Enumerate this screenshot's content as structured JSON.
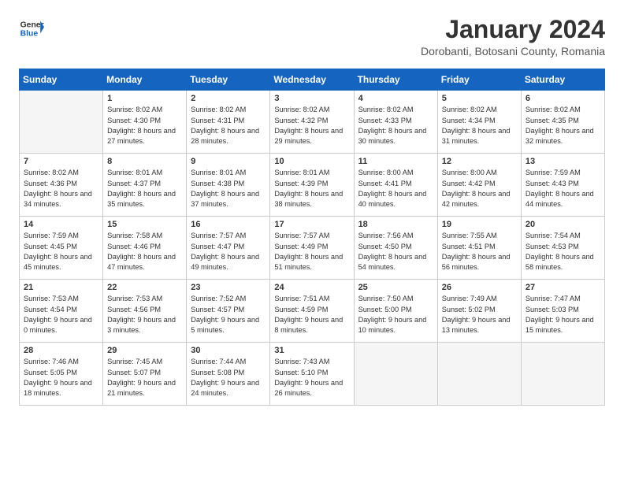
{
  "logo": {
    "line1": "General",
    "line2": "Blue"
  },
  "title": "January 2024",
  "subtitle": "Dorobanti, Botosani County, Romania",
  "days_of_week": [
    "Sunday",
    "Monday",
    "Tuesday",
    "Wednesday",
    "Thursday",
    "Friday",
    "Saturday"
  ],
  "weeks": [
    [
      {
        "day": "",
        "empty": true
      },
      {
        "day": "1",
        "sunrise": "8:02 AM",
        "sunset": "4:30 PM",
        "daylight": "8 hours and 27 minutes."
      },
      {
        "day": "2",
        "sunrise": "8:02 AM",
        "sunset": "4:31 PM",
        "daylight": "8 hours and 28 minutes."
      },
      {
        "day": "3",
        "sunrise": "8:02 AM",
        "sunset": "4:32 PM",
        "daylight": "8 hours and 29 minutes."
      },
      {
        "day": "4",
        "sunrise": "8:02 AM",
        "sunset": "4:33 PM",
        "daylight": "8 hours and 30 minutes."
      },
      {
        "day": "5",
        "sunrise": "8:02 AM",
        "sunset": "4:34 PM",
        "daylight": "8 hours and 31 minutes."
      },
      {
        "day": "6",
        "sunrise": "8:02 AM",
        "sunset": "4:35 PM",
        "daylight": "8 hours and 32 minutes."
      }
    ],
    [
      {
        "day": "7",
        "sunrise": "8:02 AM",
        "sunset": "4:36 PM",
        "daylight": "8 hours and 34 minutes."
      },
      {
        "day": "8",
        "sunrise": "8:01 AM",
        "sunset": "4:37 PM",
        "daylight": "8 hours and 35 minutes."
      },
      {
        "day": "9",
        "sunrise": "8:01 AM",
        "sunset": "4:38 PM",
        "daylight": "8 hours and 37 minutes."
      },
      {
        "day": "10",
        "sunrise": "8:01 AM",
        "sunset": "4:39 PM",
        "daylight": "8 hours and 38 minutes."
      },
      {
        "day": "11",
        "sunrise": "8:00 AM",
        "sunset": "4:41 PM",
        "daylight": "8 hours and 40 minutes."
      },
      {
        "day": "12",
        "sunrise": "8:00 AM",
        "sunset": "4:42 PM",
        "daylight": "8 hours and 42 minutes."
      },
      {
        "day": "13",
        "sunrise": "7:59 AM",
        "sunset": "4:43 PM",
        "daylight": "8 hours and 44 minutes."
      }
    ],
    [
      {
        "day": "14",
        "sunrise": "7:59 AM",
        "sunset": "4:45 PM",
        "daylight": "8 hours and 45 minutes."
      },
      {
        "day": "15",
        "sunrise": "7:58 AM",
        "sunset": "4:46 PM",
        "daylight": "8 hours and 47 minutes."
      },
      {
        "day": "16",
        "sunrise": "7:57 AM",
        "sunset": "4:47 PM",
        "daylight": "8 hours and 49 minutes."
      },
      {
        "day": "17",
        "sunrise": "7:57 AM",
        "sunset": "4:49 PM",
        "daylight": "8 hours and 51 minutes."
      },
      {
        "day": "18",
        "sunrise": "7:56 AM",
        "sunset": "4:50 PM",
        "daylight": "8 hours and 54 minutes."
      },
      {
        "day": "19",
        "sunrise": "7:55 AM",
        "sunset": "4:51 PM",
        "daylight": "8 hours and 56 minutes."
      },
      {
        "day": "20",
        "sunrise": "7:54 AM",
        "sunset": "4:53 PM",
        "daylight": "8 hours and 58 minutes."
      }
    ],
    [
      {
        "day": "21",
        "sunrise": "7:53 AM",
        "sunset": "4:54 PM",
        "daylight": "9 hours and 0 minutes."
      },
      {
        "day": "22",
        "sunrise": "7:53 AM",
        "sunset": "4:56 PM",
        "daylight": "9 hours and 3 minutes."
      },
      {
        "day": "23",
        "sunrise": "7:52 AM",
        "sunset": "4:57 PM",
        "daylight": "9 hours and 5 minutes."
      },
      {
        "day": "24",
        "sunrise": "7:51 AM",
        "sunset": "4:59 PM",
        "daylight": "9 hours and 8 minutes."
      },
      {
        "day": "25",
        "sunrise": "7:50 AM",
        "sunset": "5:00 PM",
        "daylight": "9 hours and 10 minutes."
      },
      {
        "day": "26",
        "sunrise": "7:49 AM",
        "sunset": "5:02 PM",
        "daylight": "9 hours and 13 minutes."
      },
      {
        "day": "27",
        "sunrise": "7:47 AM",
        "sunset": "5:03 PM",
        "daylight": "9 hours and 15 minutes."
      }
    ],
    [
      {
        "day": "28",
        "sunrise": "7:46 AM",
        "sunset": "5:05 PM",
        "daylight": "9 hours and 18 minutes."
      },
      {
        "day": "29",
        "sunrise": "7:45 AM",
        "sunset": "5:07 PM",
        "daylight": "9 hours and 21 minutes."
      },
      {
        "day": "30",
        "sunrise": "7:44 AM",
        "sunset": "5:08 PM",
        "daylight": "9 hours and 24 minutes."
      },
      {
        "day": "31",
        "sunrise": "7:43 AM",
        "sunset": "5:10 PM",
        "daylight": "9 hours and 26 minutes."
      },
      {
        "day": "",
        "empty": true
      },
      {
        "day": "",
        "empty": true
      },
      {
        "day": "",
        "empty": true
      }
    ]
  ]
}
